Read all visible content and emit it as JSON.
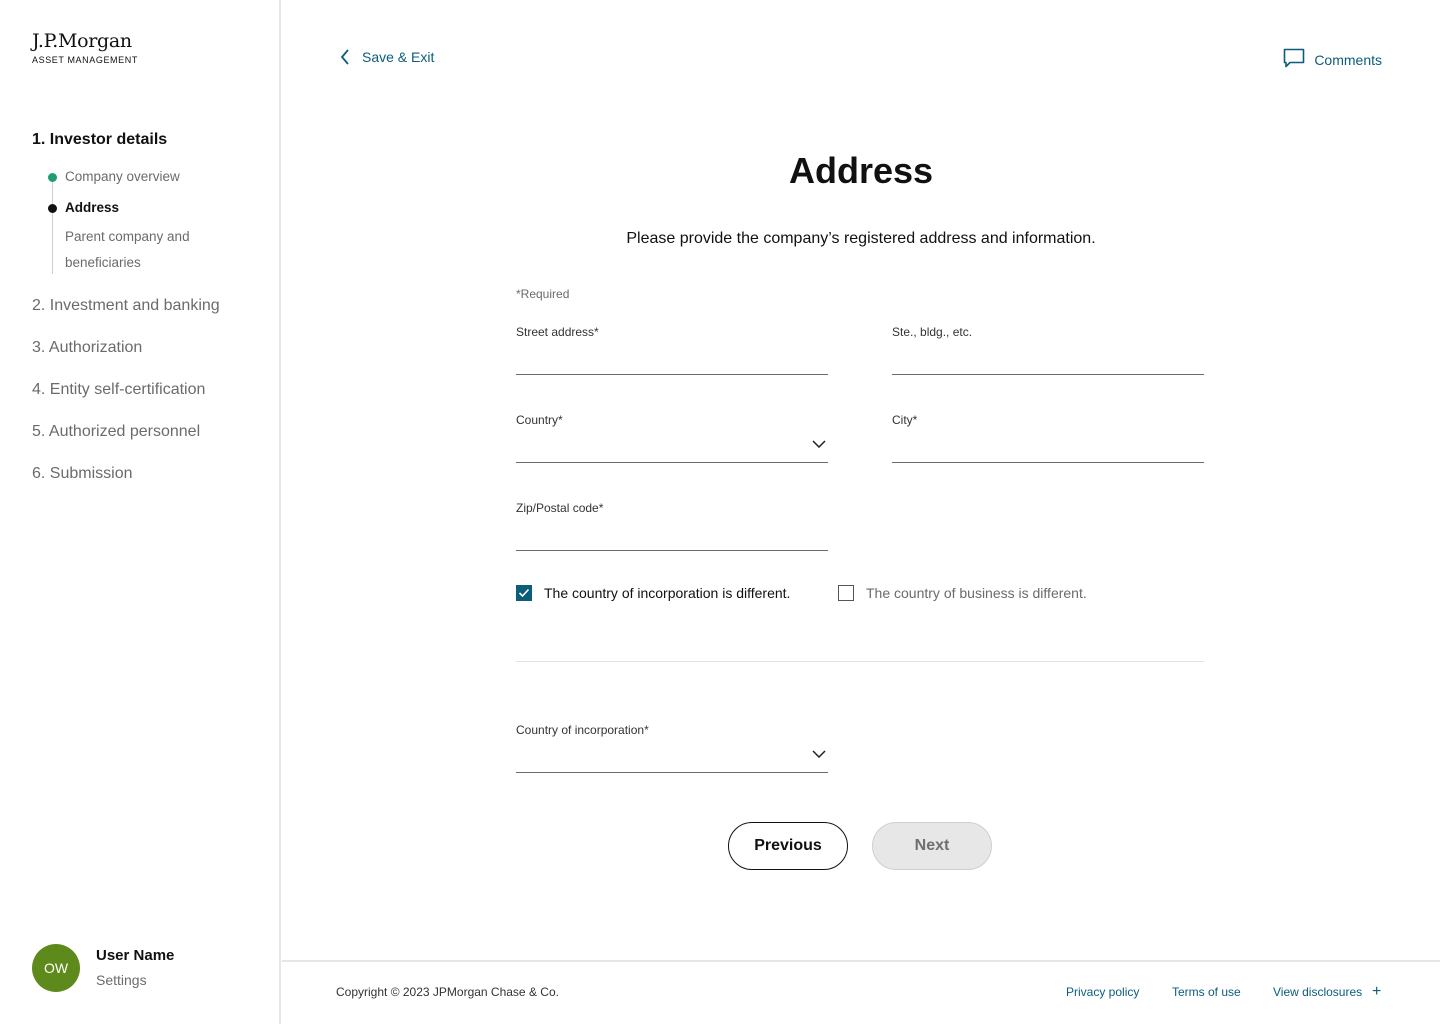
{
  "brand": {
    "logo_main": "J.P.Morgan",
    "logo_sub": "ASSET MANAGEMENT"
  },
  "sidebar": {
    "active_step": "1.  Investor details",
    "substeps": [
      {
        "label": "Company overview",
        "state": "done"
      },
      {
        "label": "Address",
        "state": "current"
      },
      {
        "label": "Parent company and beneficiaries",
        "state": "todo"
      }
    ],
    "steps": [
      "2.  Investment and banking",
      "3.  Authorization",
      "4.  Entity self-certification",
      "5.  Authorized personnel",
      "6.  Submission"
    ]
  },
  "user": {
    "initials": "OW",
    "name": "User Name",
    "settings_label": "Settings",
    "avatar_color": "#5e8a1b"
  },
  "topbar": {
    "back_label": "Save & Exit",
    "comments_label": "Comments"
  },
  "page": {
    "title": "Address",
    "subtitle": "Please provide the company’s registered address and information.",
    "required_note": "*Required"
  },
  "form": {
    "street_label": "Street address*",
    "street_value": "",
    "suite_label": "Ste., bldg., etc.",
    "suite_value": "",
    "country_label": "Country*",
    "country_value": "",
    "city_label": "City*",
    "city_value": "",
    "zip_label": "Zip/Postal code*",
    "zip_value": "",
    "incorp_checkbox_label": "The country of incorporation is different.",
    "incorp_checked": true,
    "business_checkbox_label": "The country of business is different.",
    "business_checked": false,
    "country_incorp_label": "Country of incorporation*",
    "country_incorp_value": ""
  },
  "buttons": {
    "previous": "Previous",
    "next": "Next"
  },
  "footer": {
    "copyright": "Copyright © 2023 JPMorgan Chase & Co.",
    "privacy": "Privacy policy",
    "terms": "Terms of use",
    "disclosures": "View disclosures",
    "plus": "+"
  },
  "colors": {
    "accent": "#0b5d7a",
    "done_dot": "#1f9e74"
  }
}
